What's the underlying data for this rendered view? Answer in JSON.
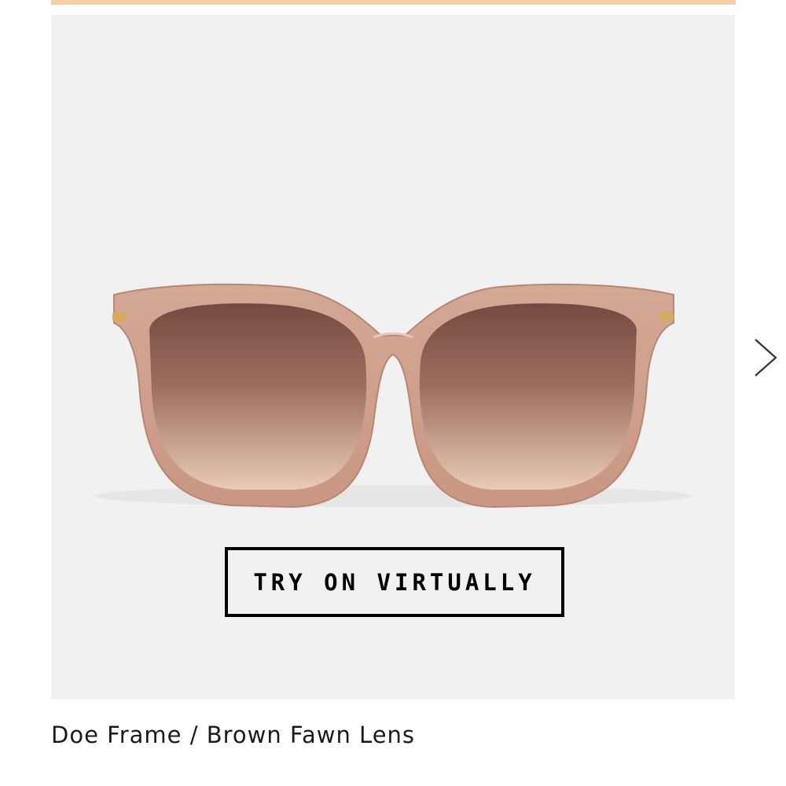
{
  "banner": {
    "color": "#f7cfa2"
  },
  "product": {
    "image_icon": "sunglasses-image",
    "background_color": "#f1f1f1",
    "frame_color": "#d7ab99",
    "lens_color": "#8a5a4a",
    "name": "Doe Frame / Brown Fawn Lens"
  },
  "try_on": {
    "label": "TRY ON VIRTUALLY"
  },
  "carousel": {
    "next_icon": "chevron-right-icon"
  }
}
